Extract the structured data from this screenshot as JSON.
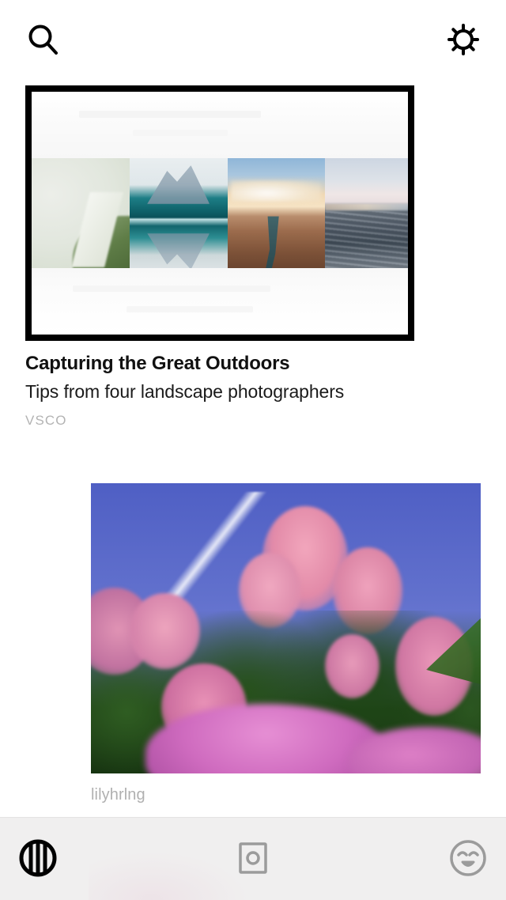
{
  "app": {
    "name": "VSCO",
    "screen": "discover-feed"
  },
  "header": {
    "search_label": "Search",
    "search_icon": "search-icon",
    "settings_label": "Settings",
    "settings_icon": "gear-icon"
  },
  "featured": {
    "title": "Capturing the Great Outdoors",
    "subtitle": "Tips from four landscape photographers",
    "publisher": "VSCO",
    "image_alt": "Four landscape photographs in a row inside a black frame",
    "thumbnails": [
      {
        "name": "misty-cliff",
        "alt": "Foggy coastal cliff with green grass"
      },
      {
        "name": "teal-lake",
        "alt": "Mountain reflected in a teal alpine lake"
      },
      {
        "name": "canyon-river",
        "alt": "River canyon at sunset"
      },
      {
        "name": "ocean-waves",
        "alt": "Ocean waves under a pale sky"
      }
    ],
    "frame_color": "#000000"
  },
  "post": {
    "username": "lilyhrlng",
    "image_alt": "Pink lilac blossoms against a deep blue sky with a jet contrail",
    "sky_color": "#6271cd",
    "blossom_color": "#e28aa8"
  },
  "bottom_nav": {
    "items": [
      {
        "name": "feed",
        "label": "Feed",
        "icon": "vsco-circle-icon",
        "active": true,
        "color": "#000000"
      },
      {
        "name": "studio",
        "label": "Studio",
        "icon": "camera-frame-icon",
        "active": false,
        "color": "#9b9b9b"
      },
      {
        "name": "profile",
        "label": "Profile",
        "icon": "smiley-face-icon",
        "active": false,
        "color": "#9b9b9b"
      }
    ],
    "background_color": "#f0efef"
  }
}
